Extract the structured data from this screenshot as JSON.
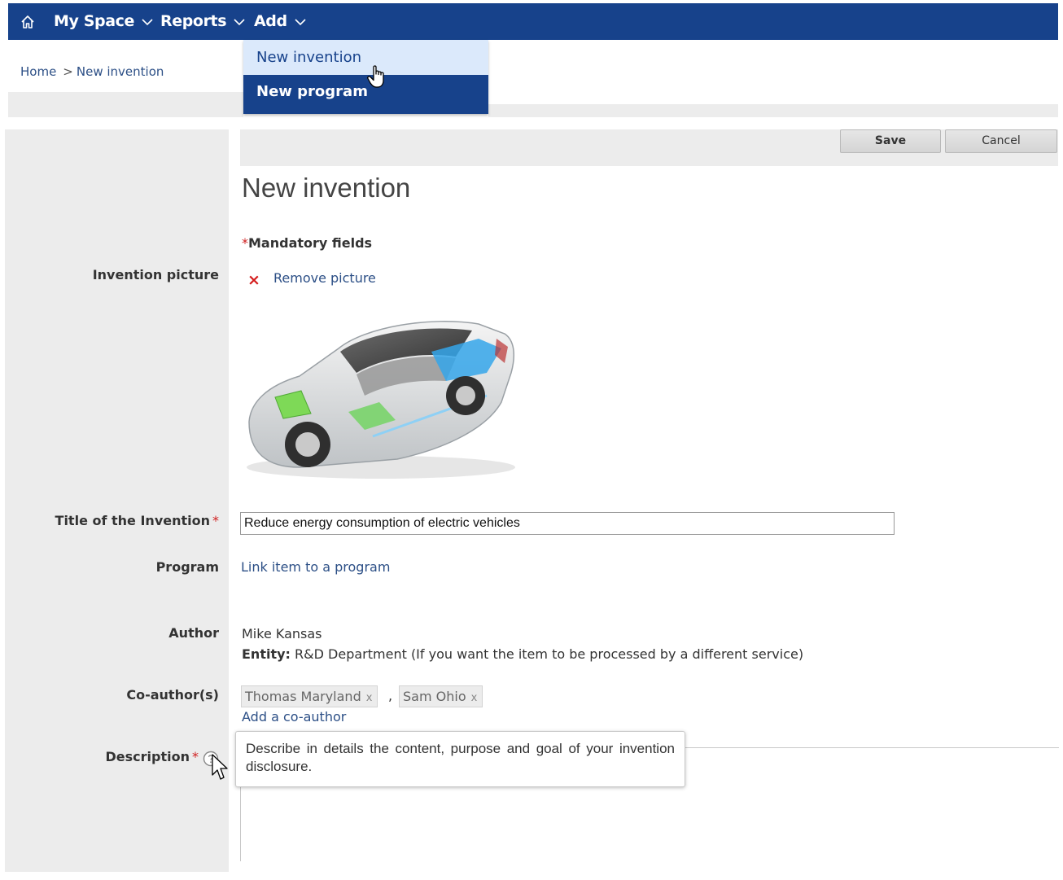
{
  "nav": {
    "my_space": "My Space",
    "reports": "Reports",
    "add": "Add",
    "nav_color": "#17428b"
  },
  "dropdown": {
    "items": [
      {
        "label": "New invention",
        "state": "hover"
      },
      {
        "label": "New program"
      }
    ]
  },
  "breadcrumb": {
    "home": "Home",
    "separator": ">",
    "current": "New invention"
  },
  "toolbar": {
    "save_label": "Save",
    "cancel_label": "Cancel"
  },
  "form": {
    "page_title": "New invention",
    "mandatory_star": "*",
    "mandatory_text": "Mandatory fields",
    "picture": {
      "label": "Invention picture",
      "remove_icon": "×",
      "remove_label": "Remove picture"
    },
    "title_field": {
      "label": "Title of the Invention",
      "required_mark": "*",
      "value": "Reduce energy consumption of electric vehicles"
    },
    "program": {
      "label": "Program",
      "link_label": "Link item to a program"
    },
    "author": {
      "label": "Author",
      "name": "Mike Kansas",
      "entity_label": "Entity:",
      "entity_value": "R&D Department (If you want the item to be processed by a different service)"
    },
    "coauthors": {
      "label": "Co-author(s)",
      "items": [
        {
          "name": "Thomas Maryland",
          "remove": "x"
        },
        {
          "name": "Sam Ohio",
          "remove": "x"
        }
      ],
      "separator": ",",
      "add_label": "Add a co-author"
    },
    "description": {
      "label": "Description",
      "required_mark": "*",
      "tooltip": "Describe in details the content, purpose and goal of your invention disclosure."
    }
  },
  "colors": {
    "accent": "#17428b",
    "link": "#2c4f86",
    "required": "#d02020",
    "panel_bg": "#ececec"
  }
}
